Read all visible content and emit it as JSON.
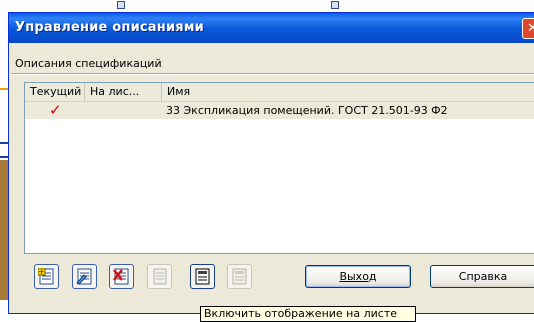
{
  "window": {
    "title": "Управление описаниями",
    "close_symbol": "✕"
  },
  "section": {
    "label": "Описания спецификаций"
  },
  "list": {
    "columns": [
      "Текущий",
      "На лис...",
      "Имя"
    ],
    "rows": [
      {
        "current": "✓",
        "on_sheet": "",
        "name": "33 Экспликация помещений. ГОСТ 21.501-93 Ф2"
      }
    ]
  },
  "toolbar": {
    "icons": [
      "add-description-icon",
      "edit-description-icon",
      "delete-description-icon",
      "disabled-sheet-icon",
      "show-on-sheet-icon",
      "disabled-options-icon"
    ]
  },
  "buttons": {
    "exit": "Выход",
    "help": "Справка"
  },
  "tooltip": {
    "text": "Включить отображение на листе"
  },
  "colors": {
    "title_bar": "#0a58d8",
    "close_button": "#e0462a",
    "check_mark": "#e00000",
    "dialog_face": "#ece9d8"
  }
}
